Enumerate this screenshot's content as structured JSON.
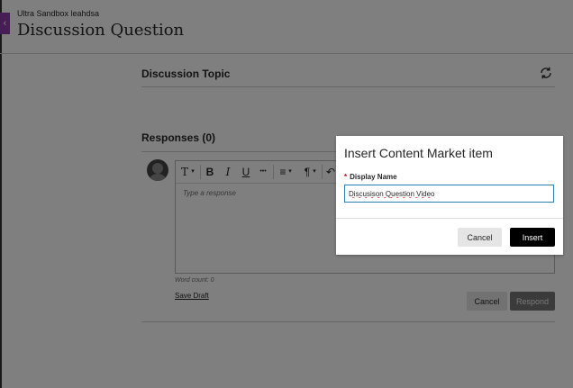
{
  "header": {
    "course_name": "Ultra Sandbox leahdsa",
    "page_title": "Discussion Question",
    "collapse_glyph": "‹"
  },
  "topic": {
    "title": "Discussion Topic",
    "refresh_icon": "refresh-icon"
  },
  "responses": {
    "title": "Responses (0)",
    "editor": {
      "toolbar": {
        "text_style": "T",
        "text_style_caret": "▾",
        "bold": "B",
        "italic": "I",
        "underline": "U",
        "more": "•••",
        "align": "≡",
        "align_caret": "▾",
        "paragraph": "¶",
        "paragraph_caret": "▾",
        "undo": "↶"
      },
      "placeholder": "Type a response"
    },
    "word_count": "Word count: 0",
    "save_draft": "Save Draft",
    "cancel_label": "Cancel",
    "respond_label": "Respond"
  },
  "dialog": {
    "title": "Insert Content Market item",
    "required_marker": "*",
    "field_label": "Display Name",
    "field_value": "Discusison Question Video",
    "cancel_label": "Cancel",
    "insert_label": "Insert"
  },
  "colors": {
    "accent_purple": "#8c3aaa",
    "focus_blue": "#2a7fb0",
    "primary_button": "#000000"
  }
}
